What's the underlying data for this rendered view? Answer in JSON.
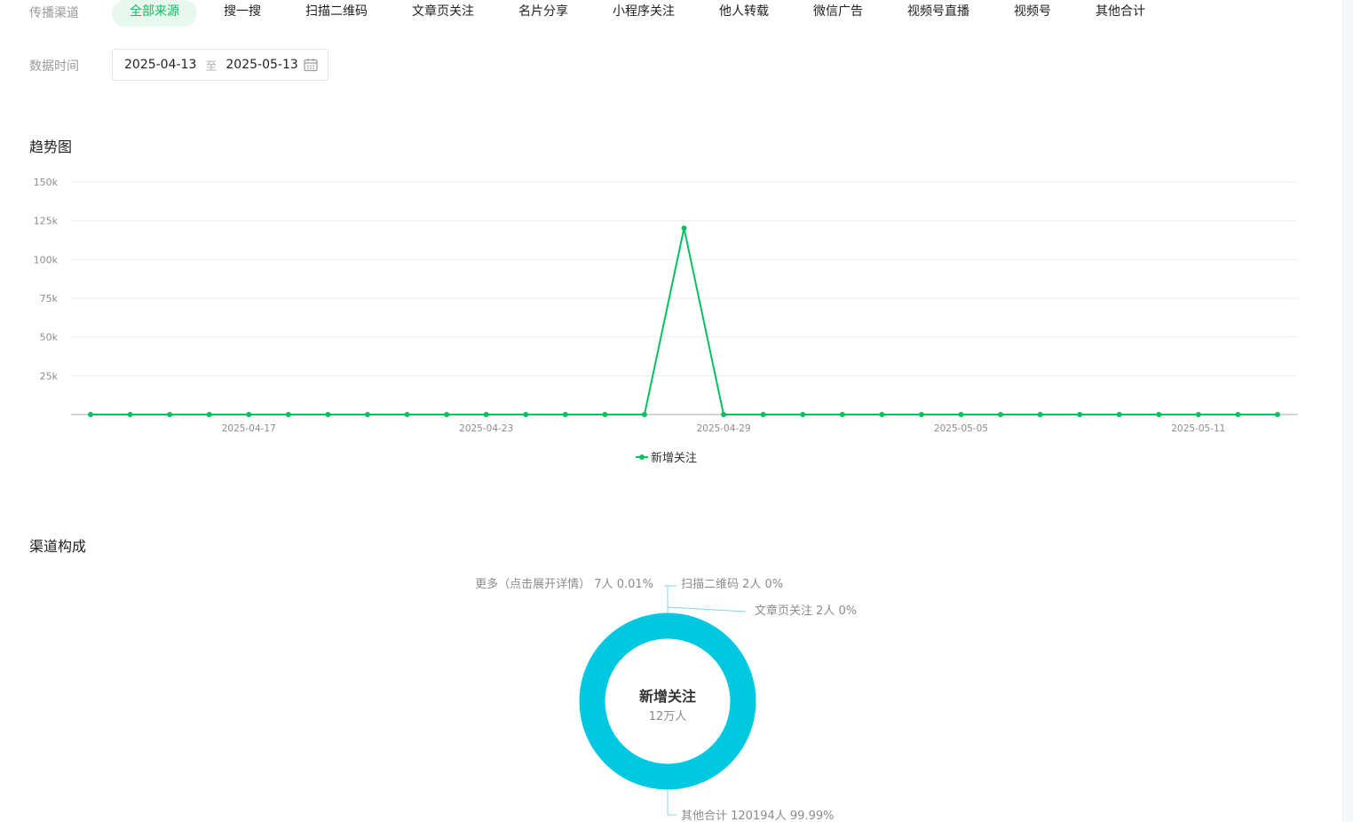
{
  "filters": {
    "channel_label": "传播渠道",
    "channels": [
      "全部来源",
      "搜一搜",
      "扫描二维码",
      "文章页关注",
      "名片分享",
      "小程序关注",
      "他人转载",
      "微信广告",
      "视频号直播",
      "视频号",
      "其他合计"
    ],
    "active_channel": "全部来源",
    "time_label": "数据时间",
    "start_date": "2025-04-13",
    "range_sep": "至",
    "end_date": "2025-05-13"
  },
  "trend": {
    "section_title": "趋势图"
  },
  "composition": {
    "section_title": "渠道构成",
    "center_title": "新增关注",
    "center_value": "12万人",
    "labels": [
      "更多（点击展开详情） 7人 0.01%",
      "扫描二维码 2人 0%",
      "文章页关注 2人 0%",
      "其他合计 120194人 99.99%"
    ]
  },
  "colors": {
    "accent_green": "#07c160",
    "donut_cyan": "#00c8e0"
  },
  "chart_data": [
    {
      "type": "line",
      "x": [
        "2025-04-13",
        "2025-04-14",
        "2025-04-15",
        "2025-04-16",
        "2025-04-17",
        "2025-04-18",
        "2025-04-19",
        "2025-04-20",
        "2025-04-21",
        "2025-04-22",
        "2025-04-23",
        "2025-04-24",
        "2025-04-25",
        "2025-04-26",
        "2025-04-27",
        "2025-04-28",
        "2025-04-29",
        "2025-04-30",
        "2025-05-01",
        "2025-05-02",
        "2025-05-03",
        "2025-05-04",
        "2025-05-05",
        "2025-05-06",
        "2025-05-07",
        "2025-05-08",
        "2025-05-09",
        "2025-05-10",
        "2025-05-11",
        "2025-05-12",
        "2025-05-13"
      ],
      "x_ticks": [
        "2025-04-17",
        "2025-04-23",
        "2025-04-29",
        "2025-05-05",
        "2025-05-11"
      ],
      "series": [
        {
          "name": "新增关注",
          "values": [
            0,
            0,
            0,
            0,
            0,
            0,
            0,
            0,
            0,
            0,
            0,
            0,
            0,
            0,
            0,
            120205,
            0,
            0,
            0,
            0,
            0,
            0,
            0,
            0,
            0,
            0,
            0,
            0,
            0,
            0,
            0
          ]
        }
      ],
      "y_ticks": [
        "25k",
        "50k",
        "75k",
        "100k",
        "125k",
        "150k"
      ],
      "ylim": [
        0,
        150000
      ],
      "grid": true,
      "legend": "bottom-center"
    },
    {
      "type": "pie",
      "categories": [
        "更多（点击展开详情）",
        "扫描二维码",
        "文章页关注",
        "其他合计"
      ],
      "values": [
        7,
        2,
        2,
        120194
      ],
      "percent_labels": [
        "0.01%",
        "0%",
        "0%",
        "99.99%"
      ]
    }
  ]
}
